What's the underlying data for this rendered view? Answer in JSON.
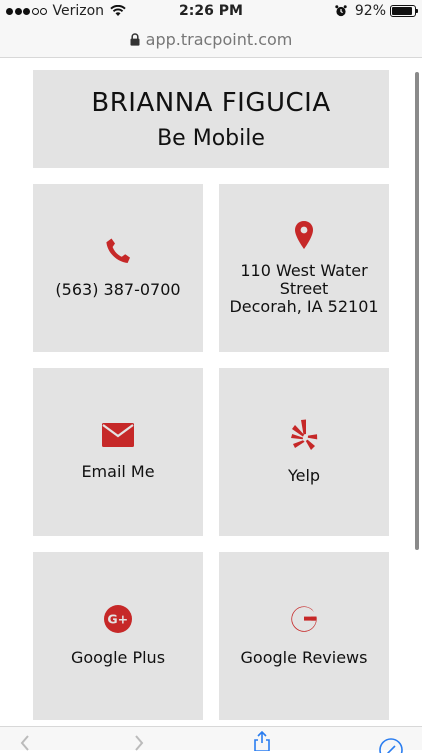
{
  "status_bar": {
    "carrier": "Verizon",
    "time": "2:26 PM",
    "battery": "92%",
    "battery_level": 0.92
  },
  "browser": {
    "url": "app.tracpoint.com"
  },
  "profile": {
    "name": "BRIANNA FIGUCIA",
    "subtitle": "Be Mobile"
  },
  "tiles": {
    "phone": {
      "label": "(563) 387-0700",
      "icon": "phone-icon"
    },
    "address": {
      "line1": "110 West Water",
      "line2": "Street",
      "line3": "Decorah, IA 52101",
      "icon": "map-pin-icon"
    },
    "email": {
      "label": "Email Me",
      "icon": "envelope-icon"
    },
    "yelp": {
      "label": "Yelp",
      "icon": "yelp-icon"
    },
    "google_plus": {
      "label": "Google Plus",
      "icon": "google-plus-icon"
    },
    "google_reviews": {
      "label": "Google Reviews",
      "icon": "google-icon"
    }
  },
  "colors": {
    "accent": "#c62828",
    "tile_bg": "#e3e3e3"
  }
}
